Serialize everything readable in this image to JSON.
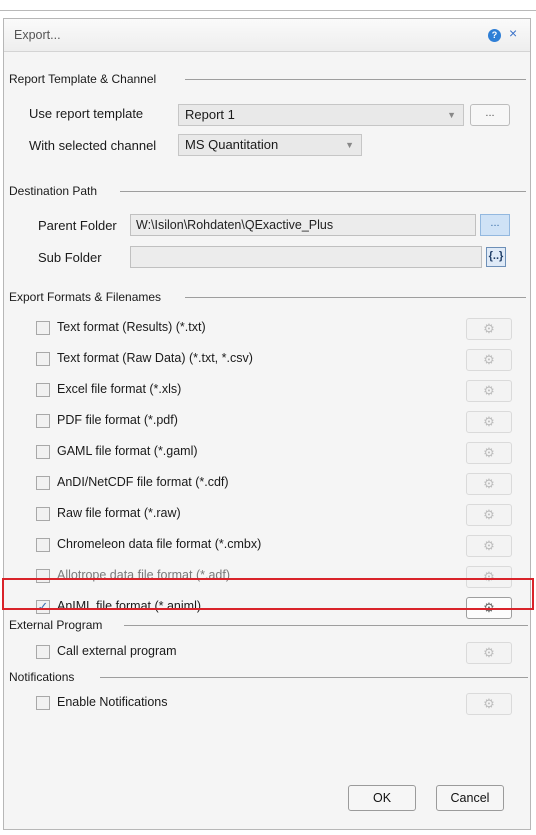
{
  "dialog": {
    "title": "Export...",
    "help_glyph": "?",
    "close_glyph": "×"
  },
  "report_section": {
    "heading": "Report Template & Channel",
    "template_label": "Use report template",
    "template_value": "Report 1",
    "browse_label": "...",
    "channel_label": "With selected channel",
    "channel_value": "MS Quantitation"
  },
  "destination": {
    "heading": "Destination Path",
    "parent_label": "Parent Folder",
    "parent_value": "W:\\Isilon\\Rohdaten\\QExactive_Plus",
    "parent_browse": "...",
    "sub_label": "Sub Folder",
    "sub_value": "",
    "brace_glyph": "{..}"
  },
  "formats": {
    "heading": "Export Formats & Filenames",
    "gear_glyph": "⚙",
    "items": [
      {
        "label": "Text format (Results) (*.txt)",
        "checked": false
      },
      {
        "label": "Text format (Raw Data) (*.txt, *.csv)",
        "checked": false
      },
      {
        "label": "Excel file format (*.xls)",
        "checked": false
      },
      {
        "label": "PDF file format (*.pdf)",
        "checked": false
      },
      {
        "label": "GAML file format (*.gaml)",
        "checked": false
      },
      {
        "label": "AnDI/NetCDF file format (*.cdf)",
        "checked": false
      },
      {
        "label": "Raw file format (*.raw)",
        "checked": false
      },
      {
        "label": "Chromeleon data file format (*.cmbx)",
        "checked": false
      },
      {
        "label": "Allotrope data file format (*.adf)",
        "checked": false
      },
      {
        "label": "AnIML file format (*.animl)",
        "checked": true
      }
    ]
  },
  "external": {
    "heading": "External Program",
    "item_label": "Call external program"
  },
  "notifications": {
    "heading": "Notifications",
    "item_label": "Enable Notifications"
  },
  "buttons": {
    "ok": "OK",
    "cancel": "Cancel"
  },
  "colors": {
    "highlight": "#d9232a",
    "accent": "#3a72c9"
  }
}
